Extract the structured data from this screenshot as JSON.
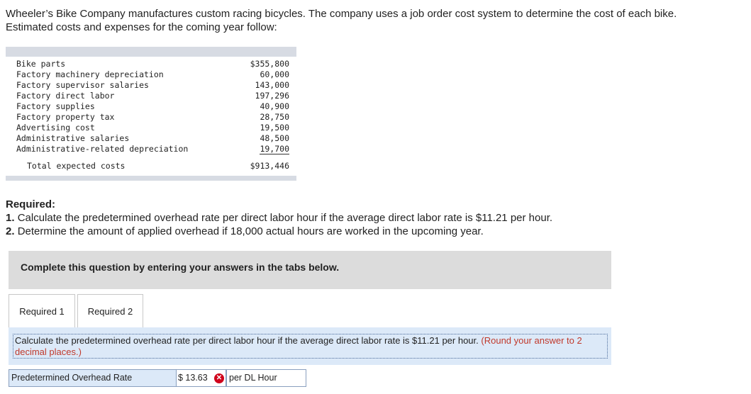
{
  "intro": "Wheeler’s Bike Company manufactures custom racing bicycles. The company uses a job order cost system to determine the cost of each bike. Estimated costs and expenses for the coming year follow:",
  "costs": {
    "rows": [
      {
        "label": "Bike parts",
        "value": "$355,800"
      },
      {
        "label": "Factory machinery depreciation",
        "value": "60,000"
      },
      {
        "label": "Factory supervisor salaries",
        "value": "143,000"
      },
      {
        "label": "Factory direct labor",
        "value": "197,296"
      },
      {
        "label": "Factory supplies",
        "value": "40,900"
      },
      {
        "label": "Factory property tax",
        "value": "28,750"
      },
      {
        "label": "Advertising cost",
        "value": "19,500"
      },
      {
        "label": "Administrative salaries",
        "value": "48,500"
      },
      {
        "label": "Administrative-related depreciation",
        "value": "19,700"
      }
    ],
    "total_label": "Total expected costs",
    "total_value": "$913,446"
  },
  "required": {
    "heading": "Required:",
    "items": [
      {
        "num": "1.",
        "text": "Calculate the predetermined overhead rate per direct labor hour if the average direct labor rate is $11.21 per hour."
      },
      {
        "num": "2.",
        "text": "Determine the amount of applied overhead if 18,000 actual hours are worked in the upcoming year."
      }
    ]
  },
  "complete_text": "Complete this question by entering your answers in the tabs below.",
  "tabs": [
    {
      "label": "Required 1"
    },
    {
      "label": "Required 2"
    }
  ],
  "instruction": {
    "text": "Calculate the predetermined overhead rate per direct labor hour if the average direct labor rate is $11.21 per hour.",
    "round": "(Round your answer to 2 decimal places.)"
  },
  "answer": {
    "label": "Predetermined Overhead Rate",
    "value": "$ 13.63",
    "status_icon": "x-circle-icon",
    "status_color": "#d0021b",
    "unit": "per DL Hour"
  }
}
